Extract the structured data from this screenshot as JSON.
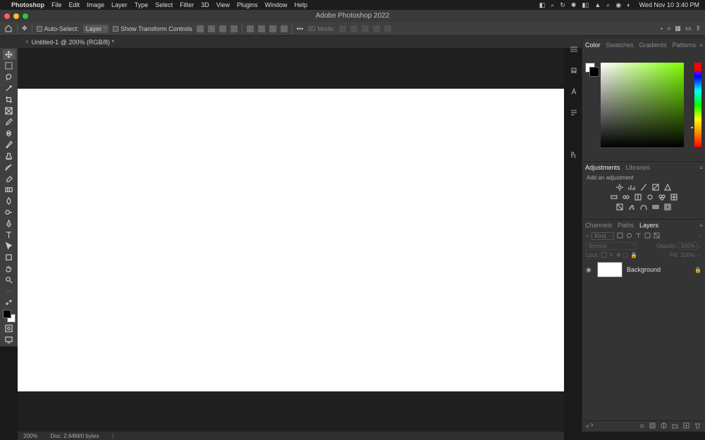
{
  "menubar": {
    "app": "Photoshop",
    "items": [
      "File",
      "Edit",
      "Image",
      "Layer",
      "Type",
      "Select",
      "Filter",
      "3D",
      "View",
      "Plugins",
      "Window",
      "Help"
    ],
    "datetime": "Wed Nov 10  3:40 PM"
  },
  "titlebar": {
    "title": "Adobe Photoshop 2022"
  },
  "options": {
    "auto_select": "Auto-Select:",
    "target": "Layer",
    "show_tc": "Show Transform Controls",
    "mode": "3D Mode:"
  },
  "doctab": {
    "close": "×",
    "name": "Untitled-1 @ 200% (RGB/8) *"
  },
  "panels": {
    "color_tabs": [
      "Color",
      "Swatches",
      "Gradients",
      "Patterns"
    ],
    "adj_tabs": [
      "Adjustments",
      "Libraries"
    ],
    "adj_hint": "Add an adjustment",
    "layer_tabs": [
      "Channels",
      "Paths",
      "Layers"
    ],
    "layers": {
      "kind": "Kind",
      "blend": "Normal",
      "opacity_lbl": "Opacity:",
      "opacity": "100%",
      "lock_lbl": "Lock:",
      "fill_lbl": "Fill:",
      "fill": "100%",
      "items": [
        {
          "name": "Background"
        }
      ]
    }
  },
  "statusbar": {
    "zoom": "200%",
    "doc": "Doc: 2.64M/0 bytes"
  }
}
